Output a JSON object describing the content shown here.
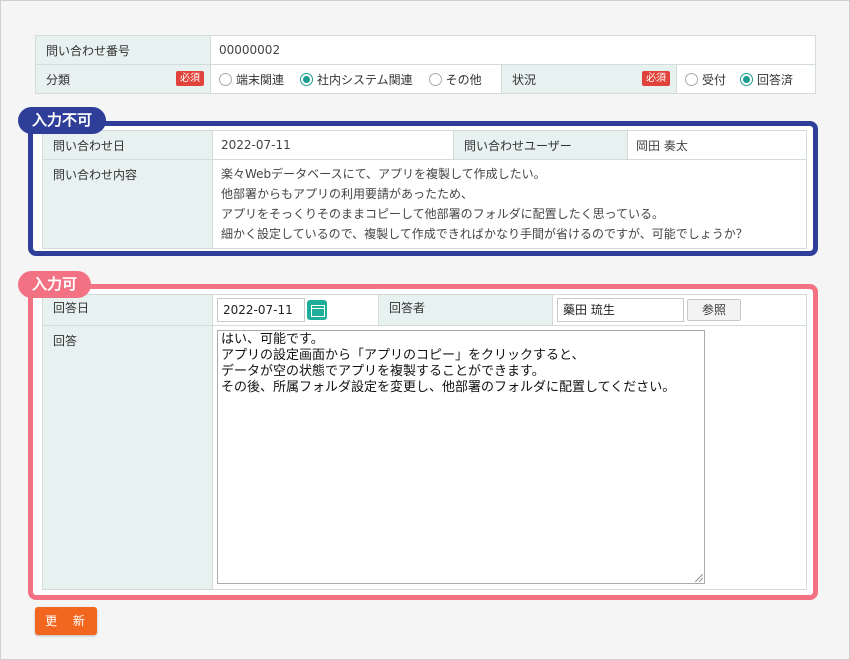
{
  "inquiry": {
    "number_label": "問い合わせ番号",
    "number_value": "00000002",
    "category_label": "分類",
    "required_badge": "必須",
    "category_options": [
      "端末関連",
      "社内システム関連",
      "その他"
    ],
    "category_selected_index": 1,
    "status_label": "状況",
    "status_options": [
      "受付",
      "回答済"
    ],
    "status_selected_index": 1
  },
  "readonly_section": {
    "tag": "入力不可",
    "date_label": "問い合わせ日",
    "date_value": "2022-07-11",
    "user_label": "問い合わせユーザー",
    "user_value": "岡田 奏太",
    "content_label": "問い合わせ内容",
    "content_lines": [
      "楽々Webデータベースにて、アプリを複製して作成したい。",
      "他部署からもアプリの利用要請があったため、",
      "アプリをそっくりそのままコピーして他部署のフォルダに配置したく思っている。",
      "細かく設定しているので、複製して作成できればかなり手間が省けるのですが、可能でしょうか？"
    ]
  },
  "editable_section": {
    "tag": "入力可",
    "answer_date_label": "回答日",
    "answer_date_value": "2022-07-11",
    "calendar_icon": "calendar-icon",
    "answerer_label": "回答者",
    "answerer_value": "藥田 琉生",
    "reference_button": "参照",
    "answer_label": "回答",
    "answer_lines": [
      "はい、可能です。",
      "アプリの設定画面から「アプリのコピー」をクリックすると、",
      "データが空の状態でアプリを複製することができます。",
      "その後、所属フォルダ設定を変更し、他部署のフォルダに配置してください。"
    ]
  },
  "actions": {
    "update_button": "更 新"
  },
  "colors": {
    "readonly_frame": "#2f3f99",
    "editable_frame": "#f27283",
    "accent_teal": "#1fae9b",
    "required_red": "#e0433b",
    "update_orange": "#f3661f"
  }
}
